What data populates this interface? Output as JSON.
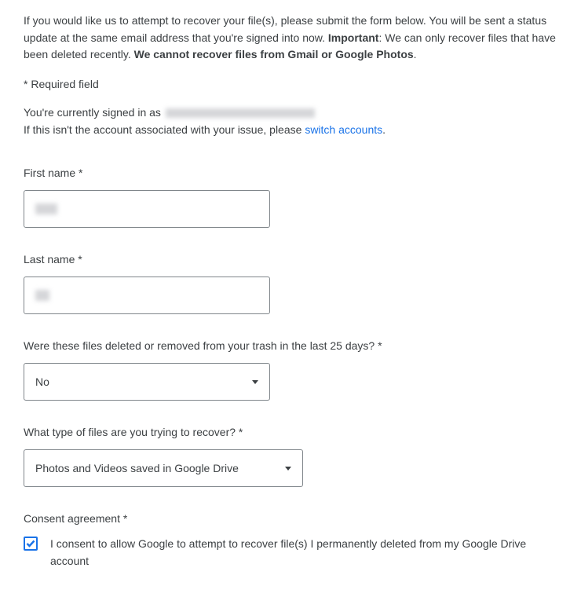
{
  "intro": {
    "part1": "If you would like us to attempt to recover your file(s), please submit the form below. You will be sent a status update at the same email address that you're signed into now. ",
    "important_label": "Important",
    "part2": ": We can only recover files that have been deleted recently. ",
    "bold_tail": "We cannot recover files from Gmail or Google Photos"
  },
  "required_note": "* Required field",
  "account": {
    "line1_prefix": "You're currently signed in as",
    "line2_prefix": "If this isn't the account associated with your issue, please ",
    "switch_link": "switch accounts",
    "period": "."
  },
  "fields": {
    "first_name": {
      "label": "First name *"
    },
    "last_name": {
      "label": "Last name *"
    },
    "deleted_recently": {
      "label": "Were these files deleted or removed from your trash in the last 25 days? *",
      "value": "No"
    },
    "file_type": {
      "label": "What type of files are you trying to recover? *",
      "value": "Photos and Videos saved in Google Drive"
    },
    "consent": {
      "label": "Consent agreement *",
      "checkbox_text": "I consent to allow Google to attempt to recover file(s) I permanently deleted from my Google Drive account",
      "checked": true
    }
  }
}
